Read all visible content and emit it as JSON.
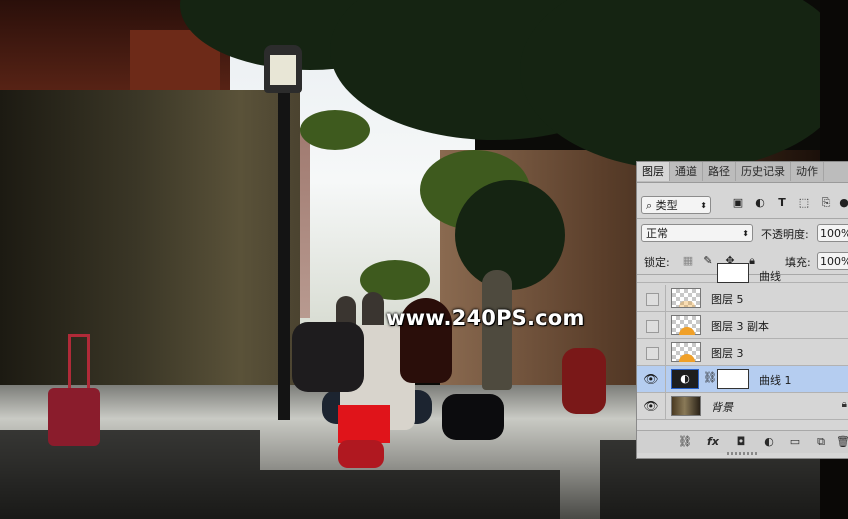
{
  "photo": {
    "watermark": "www.240PS.com"
  },
  "layers_panel": {
    "tabs": [
      "图层",
      "通道",
      "路径",
      "历史记录",
      "动作"
    ],
    "active_tab": "图层",
    "filter_kind": "类型",
    "blend_mode": "正常",
    "opacity_label": "不透明度:",
    "opacity_value": "100%",
    "lock_label": "锁定:",
    "fill_label": "填充:",
    "fill_value": "100%",
    "partial_row_name": "曲线",
    "layers": [
      {
        "name": "图层 5",
        "visible": false,
        "thumb": "transparent-sun"
      },
      {
        "name": "图层 3 副本",
        "visible": false,
        "thumb": "transparent-sun"
      },
      {
        "name": "图层 3",
        "visible": false,
        "thumb": "transparent-sun"
      },
      {
        "name": "曲线 1",
        "visible": true,
        "selected": true,
        "thumb": "curves-adjustment"
      },
      {
        "name": "背景",
        "visible": true,
        "locked": true,
        "thumb": "photo"
      }
    ],
    "bottom_icons": [
      "link-icon",
      "fx-icon",
      "add-mask-icon",
      "adjustment-icon",
      "folder-icon",
      "new-layer-icon",
      "trash-icon"
    ],
    "colors": {
      "selected_row": "#b5cdf0",
      "panel_bg": "#d6d6d6"
    }
  }
}
